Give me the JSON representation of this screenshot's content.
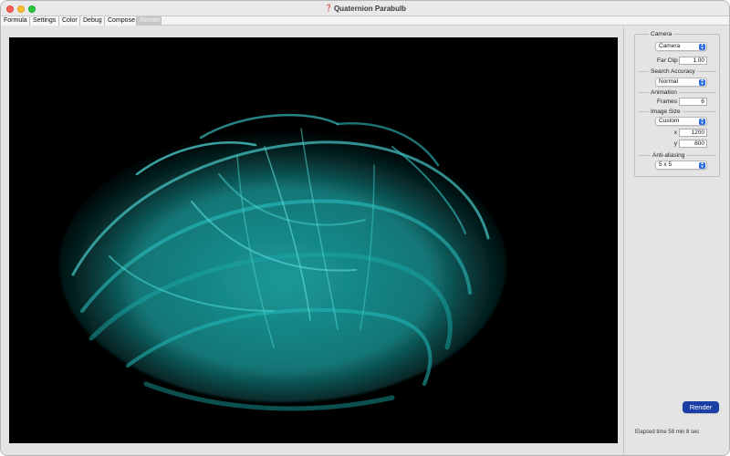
{
  "window": {
    "title": "Quaternion Parabulb"
  },
  "tabs": [
    {
      "label": "Formula"
    },
    {
      "label": "Settings"
    },
    {
      "label": "Color"
    },
    {
      "label": "Debug"
    },
    {
      "label": "Compose"
    },
    {
      "label": "Render",
      "active": true
    }
  ],
  "panel": {
    "camera": {
      "group_label": "Camera",
      "selected": "Camera",
      "far_clip_label": "Far Clip",
      "far_clip_value": "1.00"
    },
    "search_accuracy": {
      "group_label": "Search Accuracy",
      "selected": "Normal"
    },
    "animation": {
      "group_label": "Animation",
      "frames_label": "Frames",
      "frames_value": "6"
    },
    "image_size": {
      "group_label": "Image Size",
      "selected": "Custom",
      "x_label": "x",
      "x_value": "1200",
      "y_label": "y",
      "y_value": "800"
    },
    "anti_aliasing": {
      "group_label": "Anti-aliasing",
      "selected": "5 x 5"
    }
  },
  "render_button": "Render",
  "elapsed": "Elapsed time 58 min  8 sec",
  "colors": {
    "fractal": "#1fb5b5",
    "accent": "#1c3fa6"
  },
  "icons": [
    "app-icon",
    "popup-arrows-icon"
  ]
}
